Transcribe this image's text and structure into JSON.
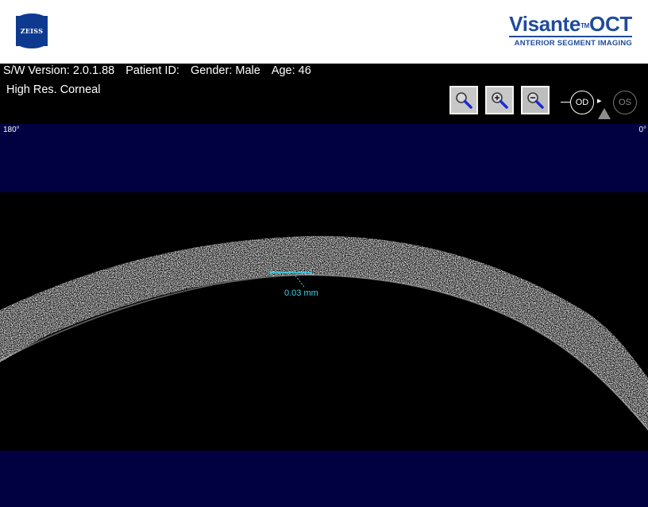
{
  "header": {
    "zeiss_logo_text": "ZEISS",
    "brand_name": "Visante",
    "brand_tm": "TM",
    "brand_suffix": "OCT",
    "brand_tagline": "ANTERIOR SEGMENT IMAGING",
    "brand_color": "#1f4b9c"
  },
  "info": {
    "sw_version": "S/W Version: 2.0.1.88",
    "patient_id": "Patient ID:",
    "gender": "Gender: Male",
    "age": "Age: 46",
    "scan_mode": "High Res. Corneal"
  },
  "toolbar": {
    "buttons": [
      {
        "name": "magnifier-button",
        "icon": "magnifier-icon"
      },
      {
        "name": "zoom-in-button",
        "icon": "zoom-in-icon"
      },
      {
        "name": "zoom-out-button",
        "icon": "zoom-out-icon"
      }
    ]
  },
  "eye_selector": {
    "od_label": "OD",
    "os_label": "OS",
    "selected": "OD",
    "arrow": "▸"
  },
  "scan": {
    "left_angle": "180°",
    "right_angle": "0°",
    "measurement_label": "0.03 mm",
    "measurement_color": "#38d6ee",
    "band_color": "#010142"
  }
}
